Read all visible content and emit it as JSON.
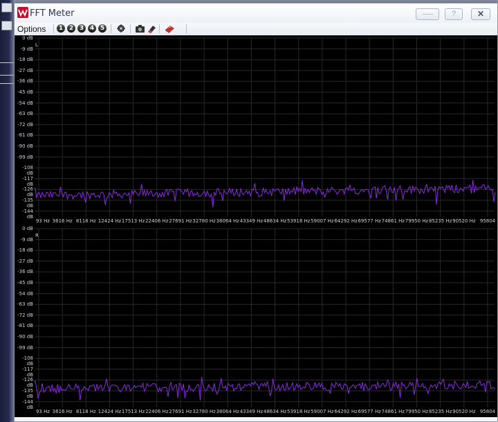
{
  "window": {
    "title": "FFT Meter",
    "help_label": "?",
    "close_label": "✕",
    "logo_icon": "app-logo-icon"
  },
  "toolbar": {
    "options_label": "Options",
    "presets": [
      "1",
      "2",
      "3",
      "4",
      "5"
    ],
    "tools": [
      "freeze-icon",
      "camera-icon",
      "eraser-icon",
      "clear-icon"
    ]
  },
  "colors": {
    "trace": "#8a2be2",
    "grid": "#2a2a2a",
    "meter_background": "#000000"
  },
  "meters": [
    {
      "channel": "L",
      "db_ticks": [
        "0 dB",
        "-9 dB",
        "-18 dB",
        "-27 dB",
        "-36 dB",
        "-45 dB",
        "-54 dB",
        "-63 dB",
        "-72 dB",
        "-81 dB",
        "-90 dB",
        "-99 dB",
        "-108 dB",
        "-117 dB",
        "-126 dB",
        "-135 dB",
        "-144 dB"
      ],
      "hz_ticks": [
        "93 Hz",
        "3616 Hz",
        "8118 Hz",
        "12424 Hz",
        "17513 Hz",
        "22406 Hz",
        "27691 Hz",
        "32780 Hz",
        "38064 Hz",
        "43349 Hz",
        "48634 Hz",
        "53918 Hz",
        "59007 Hz",
        "64292 Hz",
        "69577 Hz",
        "74861 Hz",
        "79950 Hz",
        "85235 Hz",
        "90520 Hz",
        "95804"
      ],
      "noise_floor_start_db": -131,
      "noise_floor_end_db": -125
    },
    {
      "channel": "R",
      "db_ticks": [
        "0 dB",
        "-9 dB",
        "-18 dB",
        "-27 dB",
        "-36 dB",
        "-45 dB",
        "-54 dB",
        "-63 dB",
        "-72 dB",
        "-81 dB",
        "-90 dB",
        "-99 dB",
        "-108 dB",
        "-117 dB",
        "-126 dB",
        "-135 dB",
        "-144 dB"
      ],
      "hz_ticks": [
        "93 Hz",
        "3616 Hz",
        "8118 Hz",
        "12424 Hz",
        "17513 Hz",
        "22406 Hz",
        "27691 Hz",
        "32780 Hz",
        "38064 Hz",
        "43349 Hz",
        "48634 Hz",
        "53918 Hz",
        "59007 Hz",
        "64292 Hz",
        "69577 Hz",
        "74861 Hz",
        "79950 Hz",
        "85235 Hz",
        "90520 Hz",
        "95804"
      ],
      "noise_floor_start_db": -133,
      "noise_floor_end_db": -130
    }
  ]
}
